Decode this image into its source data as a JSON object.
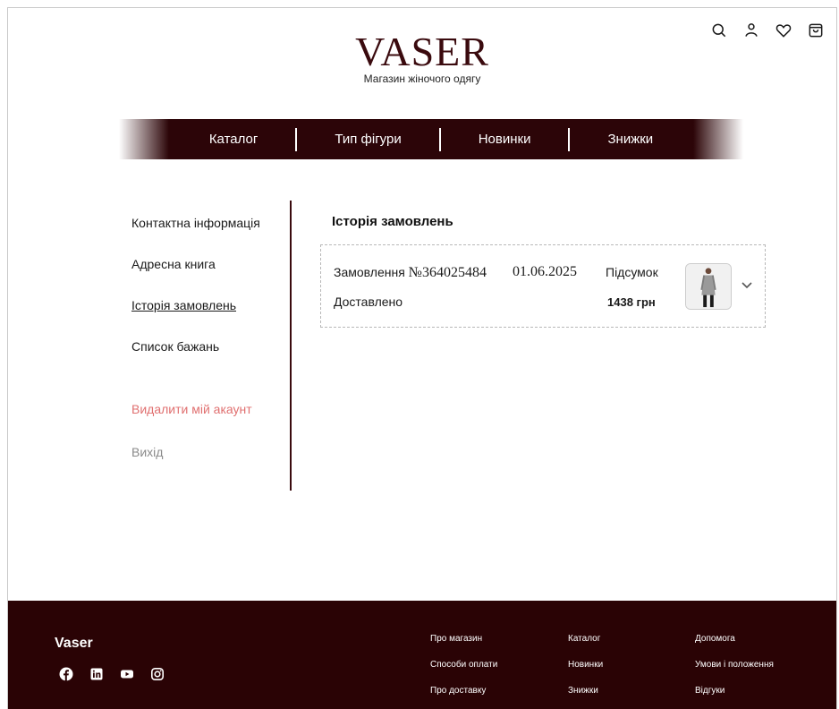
{
  "header": {
    "brand": "VASER",
    "tagline": "Магазин жіночого одягу",
    "icons": [
      "search-icon",
      "user-icon",
      "heart-icon",
      "bag-icon"
    ]
  },
  "nav": {
    "items": [
      "Каталог",
      "Тип фігури",
      "Новинки",
      "Знижки"
    ]
  },
  "sidebar": {
    "items": [
      {
        "label": "Контактна інформація"
      },
      {
        "label": "Адресна книга"
      },
      {
        "label": "Історія замовлень"
      },
      {
        "label": "Список бажань"
      },
      {
        "label": "Видалити мій акаунт"
      },
      {
        "label": "Вихід"
      }
    ]
  },
  "main": {
    "title": "Історія замовлень",
    "order": {
      "label": "Замовлення",
      "number": "№364025484",
      "date": "01.06.2025",
      "status": "Доставлено",
      "total_label": "Підсумок",
      "total_value": "1438 грн"
    }
  },
  "footer": {
    "brand": "Vaser",
    "socials": [
      "facebook-icon",
      "linkedin-icon",
      "youtube-icon",
      "instagram-icon"
    ],
    "col1": [
      "Про магазин",
      "Способи оплати",
      "Про доставку"
    ],
    "col2": [
      "Каталог",
      "Новинки",
      "Знижки"
    ],
    "col3": [
      "Допомога",
      "Умови і положення",
      "Відгуки"
    ]
  },
  "colors": {
    "brand": "#3a0a0e",
    "nav_bg": "#2c0508",
    "footer_bg": "#2a0305",
    "danger": "#e07070"
  }
}
